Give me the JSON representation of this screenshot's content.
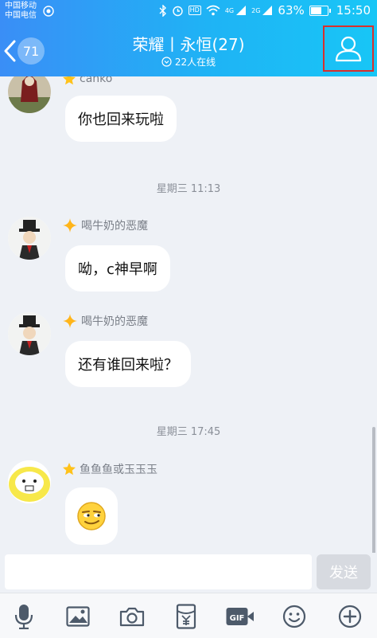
{
  "status_bar": {
    "carrier1": "中国移动",
    "carrier2": "中国电信",
    "battery": "63%",
    "time": "15:50",
    "hd_label": "HD",
    "signal1_label": "4G",
    "signal2_label": "2G",
    "icons": [
      "bluetooth-icon",
      "alarm-icon",
      "hd-icon",
      "wifi-icon",
      "signal-icon",
      "battery-icon"
    ]
  },
  "header": {
    "unread_count": "71",
    "title": "荣耀丨永恒(27)",
    "subtitle": "22人在线"
  },
  "messages": [
    {
      "sender": "canko",
      "text": "你也回来玩啦"
    },
    {
      "timestamp": "星期三 11:13"
    },
    {
      "sender": "喝牛奶的恶魔",
      "text": "呦，c神早啊"
    },
    {
      "sender": "喝牛奶的恶魔",
      "text": "还有谁回来啦？"
    },
    {
      "timestamp": "星期三 17:45"
    },
    {
      "sender": "鱼鱼鱼或玉玉玉",
      "emoji": "smirk-emoji"
    }
  ],
  "input": {
    "value": "",
    "placeholder": "",
    "send_label": "发送"
  },
  "toolbar": {
    "items": [
      "microphone-icon",
      "image-icon",
      "camera-icon",
      "red-packet-icon",
      "gif-icon",
      "emoji-icon",
      "plus-icon"
    ],
    "gif_label": "GIF"
  },
  "colors": {
    "header_gradient_start": "#3a8ef6",
    "header_gradient_end": "#18c6f6",
    "background": "#eef1f6",
    "bubble": "#ffffff",
    "highlight_box": "#d9302c"
  }
}
